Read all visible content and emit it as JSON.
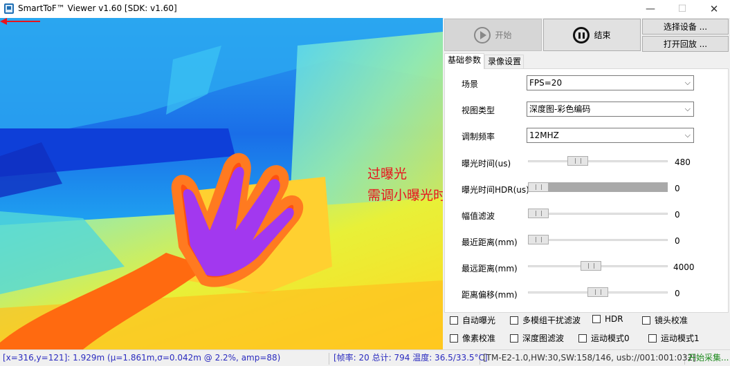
{
  "window": {
    "title": "SmartToF™ Viewer v1.60 [SDK: v1.60]",
    "min_glyph": "—",
    "max_glyph": "☐",
    "close_glyph": "✕"
  },
  "annotation": {
    "line1": "过曝光",
    "line2": "需调小曝光时间",
    "color": "#e8141d"
  },
  "toolbar": {
    "start_label": "开始",
    "end_label": "结束",
    "select_device_label": "选择设备 ...",
    "open_playback_label": "打开回放 ..."
  },
  "tabs": [
    {
      "label": "基础参数",
      "active": true
    },
    {
      "label": "录像设置",
      "active": false
    }
  ],
  "params": {
    "scene": {
      "label": "场景",
      "value": "FPS=20"
    },
    "view_type": {
      "label": "视图类型",
      "value": "深度图-彩色编码"
    },
    "mod_freq": {
      "label": "调制频率",
      "value": "12MHZ"
    }
  },
  "sliders": [
    {
      "label": "曝光时间(us)",
      "value": "480"
    },
    {
      "label": "曝光时间HDR(us)",
      "value": "0"
    },
    {
      "label": "幅值滤波",
      "value": "0"
    },
    {
      "label": "最近距离(mm)",
      "value": "0"
    },
    {
      "label": "最远距离(mm)",
      "value": "4000"
    },
    {
      "label": "距离偏移(mm)",
      "value": "0"
    }
  ],
  "checkboxes": [
    {
      "label": "自动曝光",
      "checked": false
    },
    {
      "label": "多模组干扰滤波",
      "checked": false
    },
    {
      "label": "HDR",
      "checked": false
    },
    {
      "label": "镜头校准",
      "checked": false
    },
    {
      "label": "像素校准",
      "checked": false
    },
    {
      "label": "深度图滤波",
      "checked": false
    },
    {
      "label": "运动模式0",
      "checked": false
    },
    {
      "label": "运动模式1",
      "checked": false
    }
  ],
  "status": {
    "cursor_info": "[x=316,y=121]: 1.929m (μ=1.861m,σ=0.042m @ 2.2%, amp=88)",
    "frame_info": "[帧率: 20 总计: 794 温度: 36.5/33.5°C]",
    "device_info": "[TM-E2-1.0,HW:30,SW:158/146, usb://001:001:032]",
    "run_state": "开始采集..."
  }
}
